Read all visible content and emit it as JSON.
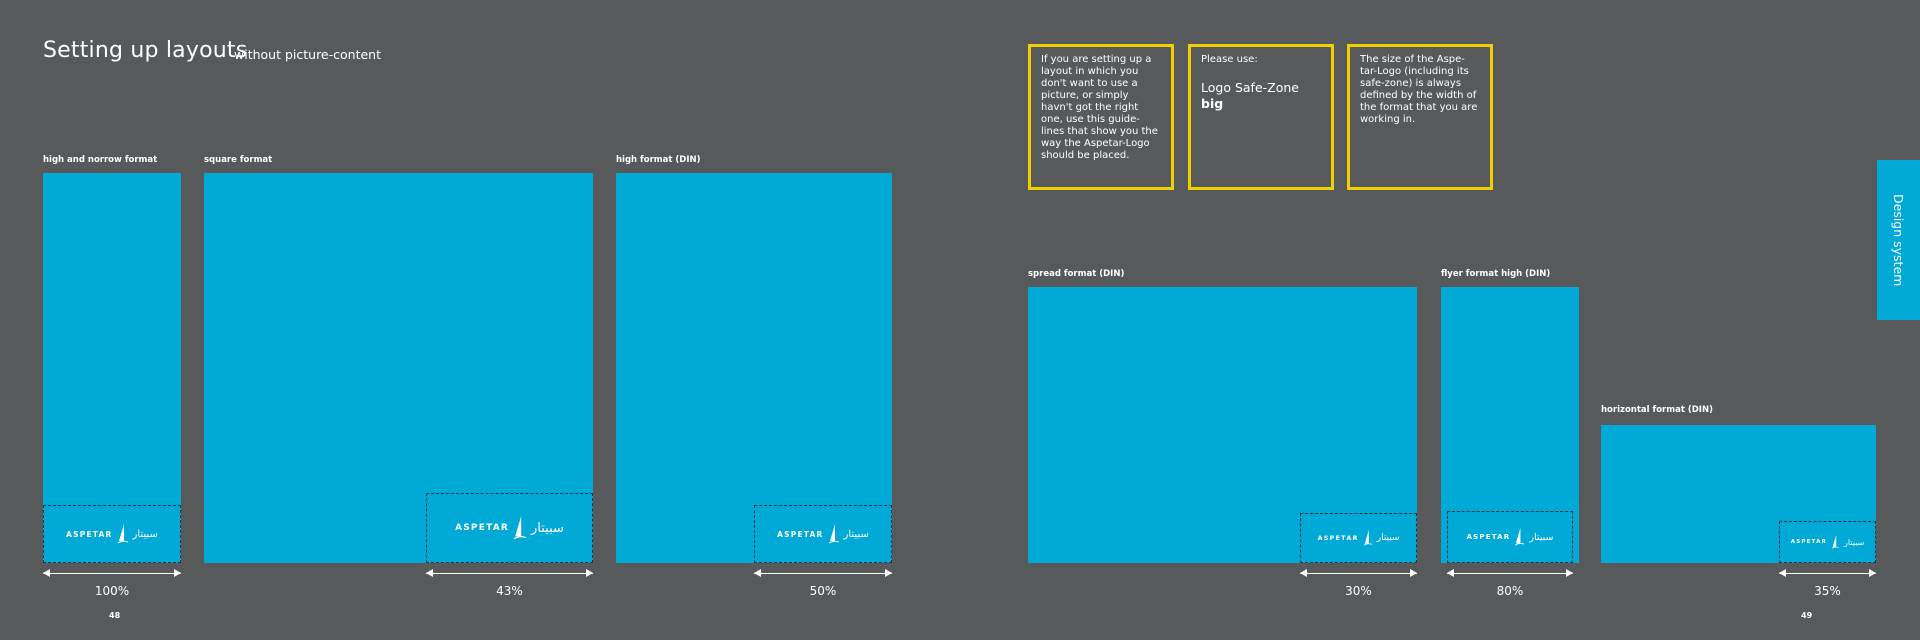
{
  "header": {
    "title": "Setting up layouts",
    "subtitle": "without picture-content"
  },
  "formats": [
    {
      "label": "high and norrow format",
      "percent": "100%"
    },
    {
      "label": "square format",
      "percent": "43%"
    },
    {
      "label": "high format (DIN)",
      "percent": "50%"
    },
    {
      "label": "spread format (DIN)",
      "percent": "30%"
    },
    {
      "label": "flyer format high (DIN)",
      "percent": "80%"
    },
    {
      "label": "horizontal format (DIN)",
      "percent": "35%"
    }
  ],
  "logo": {
    "latin": "ASPETAR",
    "arabic": "سبيتار"
  },
  "notes": {
    "box1": "If you are setting up a layout in which you don't want to use a picture, or simply havn't got the right one, use this guide-lines that show you the way the Aspetar-Logo should be placed.",
    "box2_intro": "Please use:",
    "box2_line1": "Logo Safe-Zone",
    "box2_line2": "big",
    "box3": "The size of the Aspe-tar-Logo (including its safe-zone) is always defined by the width of the format that you are working in."
  },
  "pages": {
    "left": "48",
    "right": "49"
  },
  "side_tab": {
    "label": "Design system"
  },
  "colors": {
    "background": "#58595b",
    "panel": "#00a9d6",
    "note_border": "#f0d000",
    "text": "#ffffff"
  }
}
